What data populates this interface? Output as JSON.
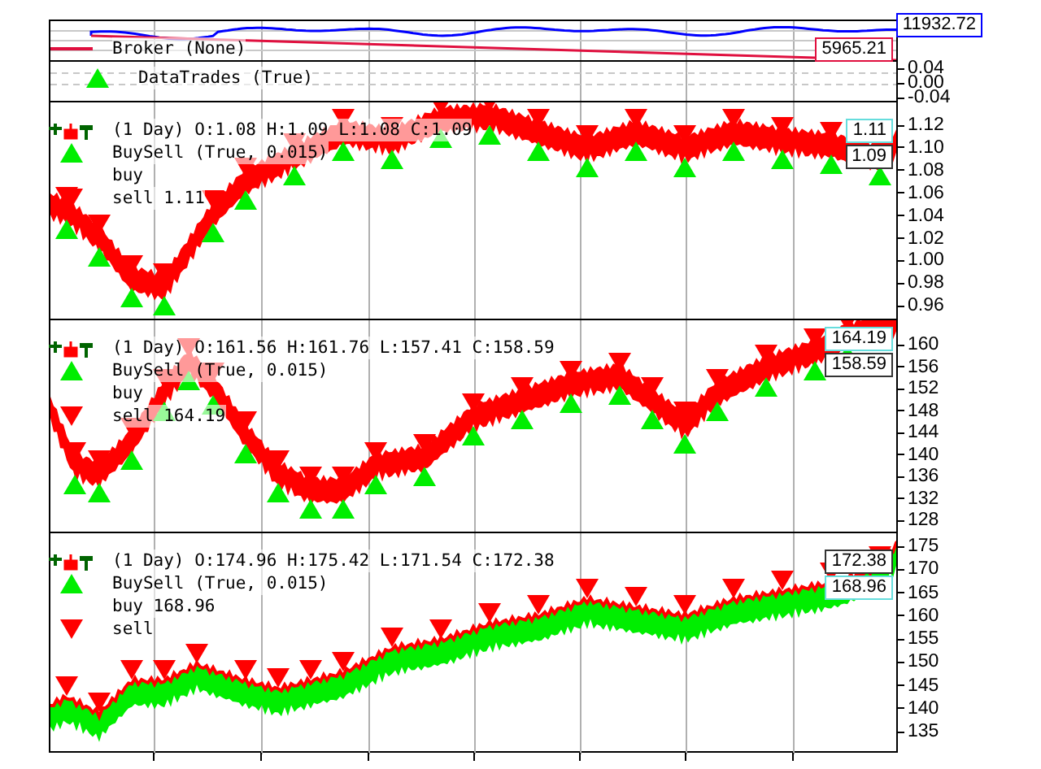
{
  "panels": [
    {
      "kind": "broker",
      "legend": [
        {
          "kind": "line",
          "text": "Broker (None)"
        }
      ],
      "tags": [
        {
          "text": "11932.72",
          "color": "#0000ff"
        },
        {
          "text": "5965.21",
          "color": "#e0103f"
        }
      ]
    },
    {
      "kind": "trades",
      "legend": [
        {
          "kind": "up",
          "text": "DataTrades (True)"
        }
      ],
      "ticks": [
        "0.04",
        "0.00",
        "-0.04"
      ]
    },
    {
      "kind": "price",
      "legend": [
        {
          "kind": "candles",
          "text": "(1 Day) O:1.08 H:1.09 L:1.08 C:1.09"
        },
        {
          "kind": "up",
          "text": "BuySell (True, 0.015)"
        },
        {
          "kind": "none",
          "text": "buy"
        },
        {
          "kind": "down",
          "text": "sell 1.11"
        }
      ],
      "ticks": [
        "1.12",
        "1.10",
        "1.08",
        "1.06",
        "1.04",
        "1.02",
        "1.00",
        "0.98",
        "0.96"
      ],
      "tags": [
        {
          "text": "1.11",
          "color": "#66dddd"
        },
        {
          "text": "1.09",
          "color": "#333333"
        }
      ]
    },
    {
      "kind": "price",
      "legend": [
        {
          "kind": "candles",
          "text": "(1 Day) O:161.56 H:161.76 L:157.41 C:158.59"
        },
        {
          "kind": "up",
          "text": "BuySell (True, 0.015)"
        },
        {
          "kind": "none",
          "text": "buy"
        },
        {
          "kind": "down",
          "text": "sell 164.19"
        }
      ],
      "ticks": [
        "160",
        "156",
        "152",
        "148",
        "144",
        "140",
        "136",
        "132",
        "128"
      ],
      "tags": [
        {
          "text": "164.19",
          "color": "#66dddd"
        },
        {
          "text": "158.59",
          "color": "#333333"
        }
      ]
    },
    {
      "kind": "price",
      "legend": [
        {
          "kind": "candles",
          "text": "(1 Day) O:174.96 H:175.42 L:171.54 C:172.38"
        },
        {
          "kind": "up",
          "text": "BuySell (True, 0.015)"
        },
        {
          "kind": "none",
          "text": "buy 168.96"
        },
        {
          "kind": "down",
          "text": "sell"
        }
      ],
      "ticks": [
        "175",
        "170",
        "165",
        "160",
        "155",
        "150",
        "145",
        "140",
        "135"
      ],
      "tags": [
        {
          "text": "172.38",
          "color": "#333333"
        },
        {
          "text": "168.96",
          "color": "#66dddd"
        }
      ]
    }
  ]
}
